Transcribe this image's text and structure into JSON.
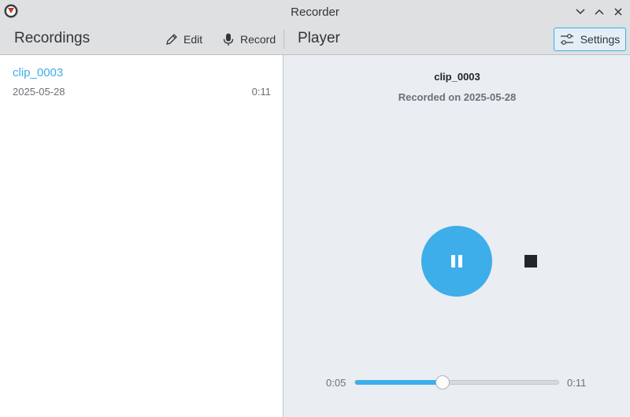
{
  "window": {
    "title": "Recorder",
    "controls": [
      "minimize-icon",
      "maximize-icon",
      "close-icon"
    ]
  },
  "toolbar": {
    "left_title": "Recordings",
    "edit_label": "Edit",
    "record_label": "Record",
    "right_title": "Player",
    "settings_label": "Settings"
  },
  "recordings": [
    {
      "name": "clip_0003",
      "date": "2025-05-28",
      "duration": "0:11"
    }
  ],
  "player": {
    "title": "clip_0003",
    "subtitle": "Recorded on 2025-05-28",
    "state": "playing",
    "current_time": "0:05",
    "total_time": "0:11",
    "progress": 0.43
  },
  "colors": {
    "accent": "#3daee9",
    "titlebar": "#dee0e2",
    "text": "#31363b"
  }
}
